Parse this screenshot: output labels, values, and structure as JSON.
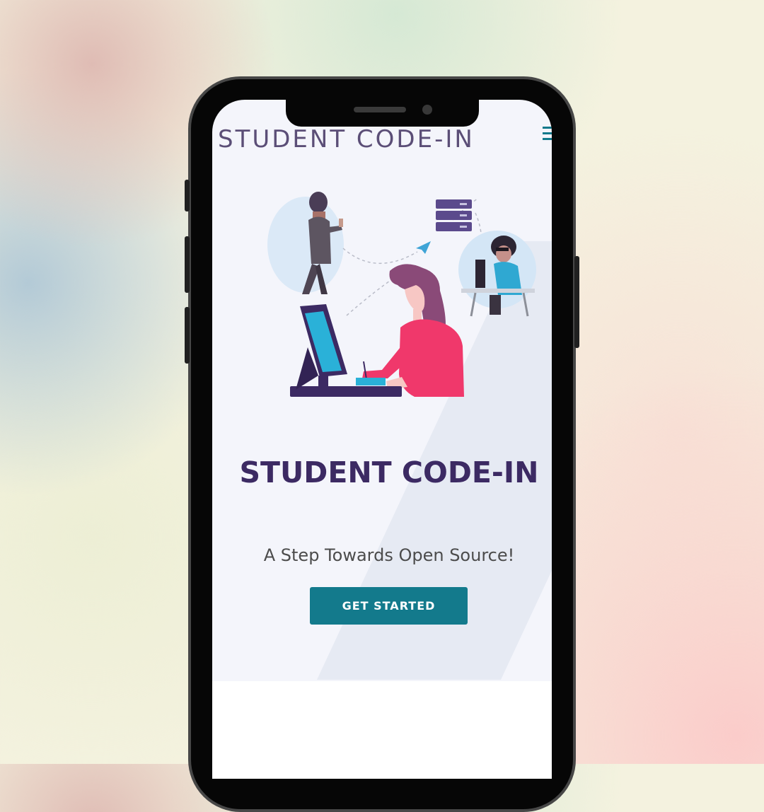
{
  "header": {
    "brand": "STUDENT CODE-IN"
  },
  "hero": {
    "title": "STUDENT CODE-IN",
    "tagline": "A Step Towards Open Source!",
    "cta_label": "GET STARTED"
  },
  "icons": {
    "menu": "hamburger-menu-icon",
    "illustration": "developers-collaborating-illustration"
  },
  "colors": {
    "accent": "#137a8c",
    "title": "#3c2a63",
    "brand": "#5b4e77",
    "background": "#f4f5fb"
  }
}
